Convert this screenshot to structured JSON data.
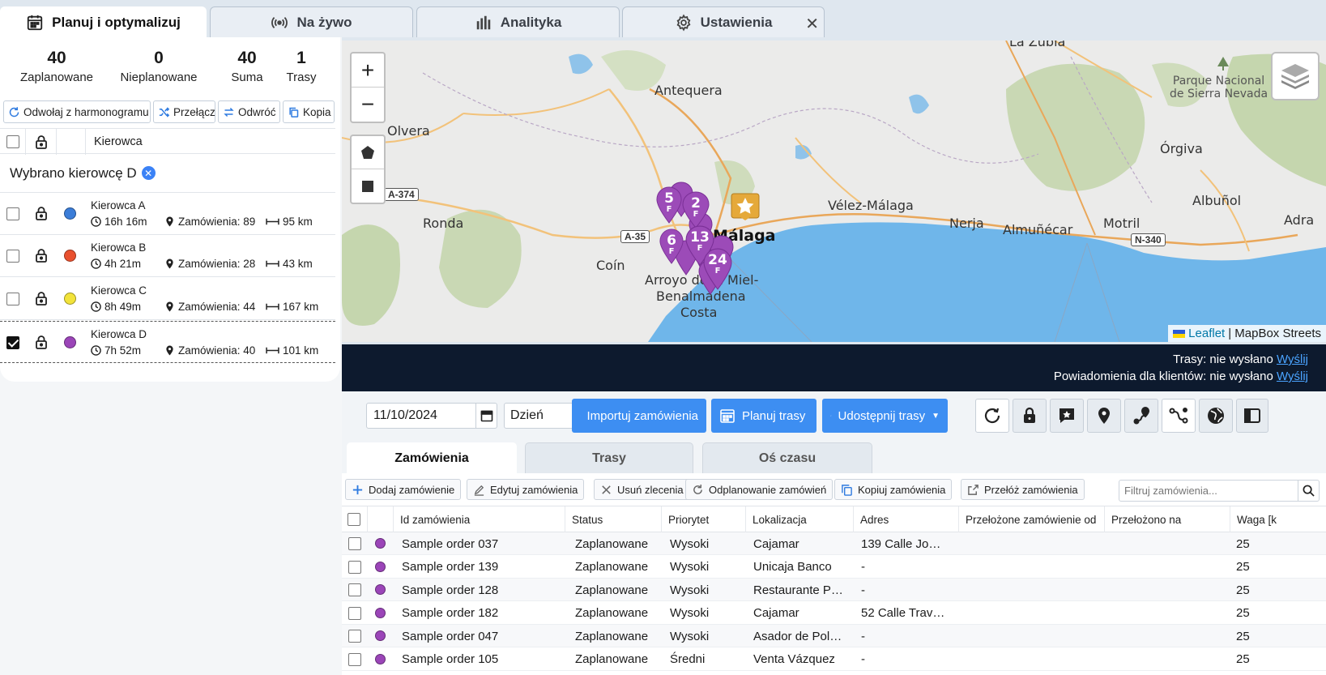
{
  "tabs": [
    {
      "label": "Planuj i optymalizuj",
      "icon": "calendar-icon"
    },
    {
      "label": "Na żywo",
      "icon": "broadcast-icon"
    },
    {
      "label": "Analityka",
      "icon": "bar-chart-icon"
    },
    {
      "label": "Ustawienia",
      "icon": "gear-icon"
    }
  ],
  "stats": [
    {
      "value": "40",
      "label": "Zaplanowane"
    },
    {
      "value": "0",
      "label": "Nieplanowane"
    },
    {
      "value": "40",
      "label": "Suma"
    },
    {
      "value": "1",
      "label": "Trasy"
    }
  ],
  "actions": {
    "unschedule": "Odwołaj z harmonogramu",
    "switch": "Przełącz",
    "reverse": "Odwróć",
    "copy": "Kopia"
  },
  "driver_table": {
    "header_driver": "Kierowca",
    "selected_text": "Wybrano kierowcę D",
    "drivers": [
      {
        "name": "Kierowca A",
        "time": "16h 16m",
        "orders": "Zamówienia: 89",
        "distance": "95 km",
        "color": "#3b7dd8",
        "checked": false
      },
      {
        "name": "Kierowca B",
        "time": "4h 21m",
        "orders": "Zamówienia: 28",
        "distance": "43 km",
        "color": "#e9502e",
        "checked": false
      },
      {
        "name": "Kierowca C",
        "time": "8h 49m",
        "orders": "Zamówienia: 44",
        "distance": "167 km",
        "color": "#f2e33a",
        "checked": false
      },
      {
        "name": "Kierowca D",
        "time": "7h 52m",
        "orders": "Zamówienia: 40",
        "distance": "101 km",
        "color": "#9b45b8",
        "checked": true
      }
    ]
  },
  "map": {
    "places": [
      "La Zubia",
      "Antequera",
      "Olvera",
      "Órgiva",
      "Vélez-Málaga",
      "Albuñol",
      "Ronda",
      "Nerja",
      "Almuñécar",
      "Motril",
      "Adra",
      "Coín",
      "Málaga",
      "Arroyo de la Miel-",
      "Benalmádena",
      "Costa"
    ],
    "park": [
      "Parque Nacional",
      "de Sierra Nevada"
    ],
    "roads": [
      "A-374",
      "A-35",
      "N-340"
    ],
    "pins": [
      "5",
      "2",
      "6",
      "13",
      "24"
    ],
    "pin_sub": "F",
    "attribution_link": "Leaflet",
    "attribution_text": "| MapBox Streets"
  },
  "status": {
    "routes_label": "Trasy: nie wysłano",
    "notify_label": "Powiadomienia dla klientów: nie wysłano",
    "send_link": "Wyślij"
  },
  "toolbar": {
    "date": "11/10/2024",
    "period": "Dzień",
    "import": "Importuj zamówienia",
    "plan": "Planuj trasy",
    "share": "Udostępnij trasy"
  },
  "subtabs": [
    "Zamówienia",
    "Trasy",
    "Oś czasu"
  ],
  "grid_actions": {
    "add": "Dodaj zamówienie",
    "edit": "Edytuj zamówienia",
    "delete": "Usuń zlecenia",
    "unplan": "Odplanowanie zamówień",
    "copy": "Kopiuj zamówienia",
    "move": "Przełóż zamówienia",
    "filter_placeholder": "Filtruj zamówienia..."
  },
  "orders": {
    "columns": [
      "Id zamówienia",
      "Status",
      "Priorytet",
      "Lokalizacja",
      "Adres",
      "Przełożone zamówienie od",
      "Przełożono na",
      "Waga [k"
    ],
    "rows": [
      {
        "id": "Sample order 037",
        "status": "Zaplanowane",
        "priority": "Wysoki",
        "location": "Cajamar",
        "address": "139 Calle Jo…",
        "weight": "25"
      },
      {
        "id": "Sample order 139",
        "status": "Zaplanowane",
        "priority": "Wysoki",
        "location": "Unicaja Banco",
        "address": "-",
        "weight": "25"
      },
      {
        "id": "Sample order 128",
        "status": "Zaplanowane",
        "priority": "Wysoki",
        "location": "Restaurante P…",
        "address": "-",
        "weight": "25"
      },
      {
        "id": "Sample order 182",
        "status": "Zaplanowane",
        "priority": "Wysoki",
        "location": "Cajamar",
        "address": "52 Calle Trav…",
        "weight": "25"
      },
      {
        "id": "Sample order 047",
        "status": "Zaplanowane",
        "priority": "Wysoki",
        "location": "Asador de Pol…",
        "address": "-",
        "weight": "25"
      },
      {
        "id": "Sample order 105",
        "status": "Zaplanowane",
        "priority": "Średni",
        "location": "Venta Vázquez",
        "address": "-",
        "weight": "25"
      }
    ],
    "row_color": "#9b45b8"
  }
}
